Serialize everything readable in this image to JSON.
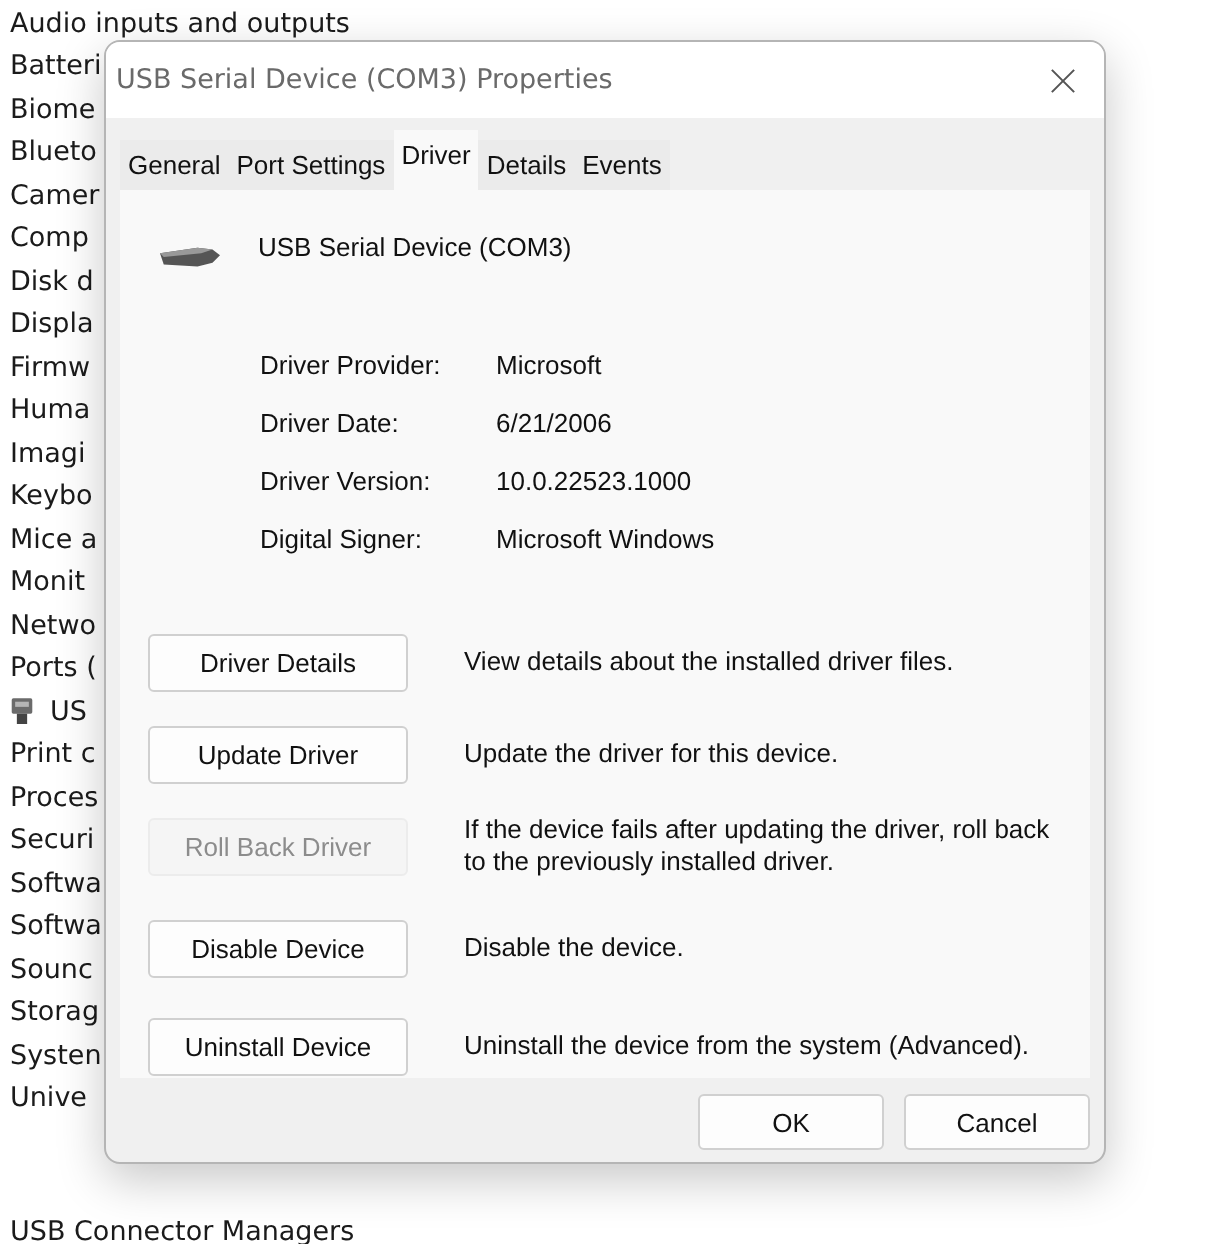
{
  "device_list": {
    "items": [
      {
        "kind": "category",
        "label": "Audio inputs and outputs"
      },
      {
        "kind": "category",
        "label": "Batteri"
      },
      {
        "kind": "category",
        "label": "Biome"
      },
      {
        "kind": "category",
        "label": "Blueto"
      },
      {
        "kind": "category",
        "label": "Camer"
      },
      {
        "kind": "category",
        "label": "Comp"
      },
      {
        "kind": "category",
        "label": "Disk d"
      },
      {
        "kind": "category",
        "label": "Displa"
      },
      {
        "kind": "category",
        "label": "Firmw"
      },
      {
        "kind": "category",
        "label": "Huma"
      },
      {
        "kind": "category",
        "label": "Imagi"
      },
      {
        "kind": "category",
        "label": "Keybo"
      },
      {
        "kind": "category",
        "label": "Mice a"
      },
      {
        "kind": "category",
        "label": "Monit"
      },
      {
        "kind": "category",
        "label": "Netwo"
      },
      {
        "kind": "category",
        "label": "Ports ("
      },
      {
        "kind": "device",
        "label": "US"
      },
      {
        "kind": "category",
        "label": "Print c"
      },
      {
        "kind": "category",
        "label": "Proces"
      },
      {
        "kind": "category",
        "label": "Securi"
      },
      {
        "kind": "category",
        "label": "Softwa"
      },
      {
        "kind": "category",
        "label": "Softwa"
      },
      {
        "kind": "category",
        "label": "Sounc"
      },
      {
        "kind": "category",
        "label": "Storag"
      },
      {
        "kind": "category",
        "label": "Systen"
      },
      {
        "kind": "category",
        "label": "Unive"
      },
      {
        "kind": "category",
        "label": "USB Connector Managers"
      }
    ]
  },
  "dialog": {
    "title": "USB Serial Device (COM3) Properties",
    "tabs": [
      {
        "label": "General",
        "selected": false
      },
      {
        "label": "Port Settings",
        "selected": false
      },
      {
        "label": "Driver",
        "selected": true
      },
      {
        "label": "Details",
        "selected": false
      },
      {
        "label": "Events",
        "selected": false
      }
    ],
    "device_name": "USB Serial Device (COM3)",
    "properties": [
      {
        "label": "Driver Provider:",
        "value": "Microsoft"
      },
      {
        "label": "Driver Date:",
        "value": "6/21/2006"
      },
      {
        "label": "Driver Version:",
        "value": "10.0.22523.1000"
      },
      {
        "label": "Digital Signer:",
        "value": "Microsoft Windows"
      }
    ],
    "actions": [
      {
        "button": "Driver Details",
        "disabled": false,
        "description": "View details about the installed driver files."
      },
      {
        "button": "Update Driver",
        "disabled": false,
        "description": "Update the driver for this device."
      },
      {
        "button": "Roll Back Driver",
        "disabled": true,
        "description": "If the device fails after updating the driver, roll back to the previously installed driver."
      },
      {
        "button": "Disable Device",
        "disabled": false,
        "description": "Disable the device."
      },
      {
        "button": "Uninstall Device",
        "disabled": false,
        "description": "Uninstall the device from the system (Advanced)."
      }
    ],
    "buttons": [
      "OK",
      "Cancel"
    ]
  }
}
